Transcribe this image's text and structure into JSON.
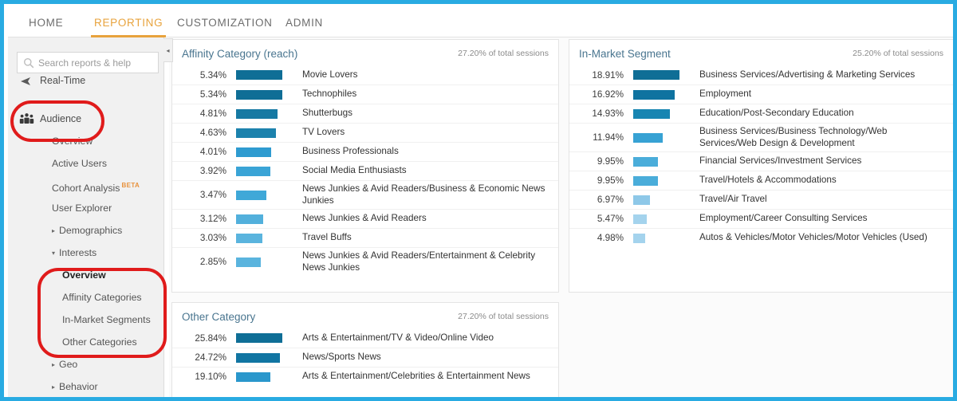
{
  "app": {
    "accent_orange": "#e8a33d",
    "annotation_red": "#e01b1b",
    "frame_blue": "#29abe2",
    "panel_title_color": "#49758f"
  },
  "topnav": {
    "tabs": [
      {
        "label": "HOME",
        "active": false
      },
      {
        "label": "REPORTING",
        "active": true
      },
      {
        "label": "CUSTOMIZATION",
        "active": false
      },
      {
        "label": "ADMIN",
        "active": false
      }
    ]
  },
  "sidebar": {
    "search": {
      "placeholder": "Search reports & help",
      "value": ""
    },
    "realtime_label": "Real-Time",
    "audience_label": "Audience",
    "items": [
      {
        "label": "Overview"
      },
      {
        "label": "Active Users"
      },
      {
        "label": "Cohort Analysis",
        "badge": "BETA"
      },
      {
        "label": "User Explorer"
      }
    ],
    "groups": [
      {
        "label": "Demographics",
        "expanded": false,
        "caret": "▸"
      },
      {
        "label": "Interests",
        "expanded": true,
        "caret": "▾"
      },
      {
        "label": "Geo",
        "expanded": false,
        "caret": "▸"
      },
      {
        "label": "Behavior",
        "expanded": false,
        "caret": "▸"
      }
    ],
    "interests_children": [
      {
        "label": "Overview",
        "selected": true
      },
      {
        "label": "Affinity Categories",
        "selected": false
      },
      {
        "label": "In-Market Segments",
        "selected": false
      },
      {
        "label": "Other Categories",
        "selected": false
      }
    ],
    "collapse_arrow": "◂"
  },
  "chart_data": [
    {
      "type": "bar",
      "title": "Affinity Category (reach)",
      "subtitle": "27.20% of total sessions",
      "xlabel": "",
      "ylabel": "",
      "orientation": "horizontal",
      "max_value": 5.34,
      "categories": [
        "Movie Lovers",
        "Technophiles",
        "Shutterbugs",
        "TV Lovers",
        "Business Professionals",
        "Social Media Enthusiasts",
        "News Junkies & Avid Readers/Business & Economic News Junkies",
        "News Junkies & Avid Readers",
        "Travel Buffs",
        "News Junkies & Avid Readers/Entertainment & Celebrity News Junkies"
      ],
      "values": [
        5.34,
        5.34,
        4.81,
        4.63,
        4.01,
        3.92,
        3.47,
        3.12,
        3.03,
        2.85
      ],
      "value_labels": [
        "5.34%",
        "5.34%",
        "4.81%",
        "4.63%",
        "4.01%",
        "3.92%",
        "3.47%",
        "3.12%",
        "3.03%",
        "2.85%"
      ],
      "bar_colors": [
        "#0f6e96",
        "#0f6e96",
        "#1679a3",
        "#1c82ad",
        "#2e9bd0",
        "#3aa4d6",
        "#3fa8d8",
        "#52b0dc",
        "#5ab4de",
        "#5ab4de"
      ]
    },
    {
      "type": "bar",
      "title": "In-Market Segment",
      "subtitle": "25.20% of total sessions",
      "xlabel": "",
      "ylabel": "",
      "orientation": "horizontal",
      "max_value": 18.91,
      "categories": [
        "Business Services/Advertising & Marketing Services",
        "Employment",
        "Education/Post-Secondary Education",
        "Business Services/Business Technology/Web Services/Web Design & Development",
        "Financial Services/Investment Services",
        "Travel/Hotels & Accommodations",
        "Travel/Air Travel",
        "Employment/Career Consulting Services",
        "Autos & Vehicles/Motor Vehicles/Motor Vehicles (Used)"
      ],
      "values": [
        18.91,
        16.92,
        14.93,
        11.94,
        9.95,
        9.95,
        6.97,
        5.47,
        4.98
      ],
      "value_labels": [
        "18.91%",
        "16.92%",
        "14.93%",
        "11.94%",
        "9.95%",
        "9.95%",
        "6.97%",
        "5.47%",
        "4.98%"
      ],
      "bar_colors": [
        "#0f6e96",
        "#0f73a0",
        "#1785b2",
        "#37a2d4",
        "#4aadda",
        "#4aadda",
        "#8ec8e8",
        "#a4d3ed",
        "#a4d3ed"
      ]
    },
    {
      "type": "bar",
      "title": "Other Category",
      "subtitle": "27.20% of total sessions",
      "xlabel": "",
      "ylabel": "",
      "orientation": "horizontal",
      "max_value": 25.84,
      "categories": [
        "Arts & Entertainment/TV & Video/Online Video",
        "News/Sports News",
        "Arts & Entertainment/Celebrities & Entertainment News"
      ],
      "values": [
        25.84,
        24.72,
        19.1
      ],
      "value_labels": [
        "25.84%",
        "24.72%",
        "19.10%"
      ],
      "bar_colors": [
        "#0f6e96",
        "#1175a2",
        "#2a97cc"
      ]
    }
  ]
}
